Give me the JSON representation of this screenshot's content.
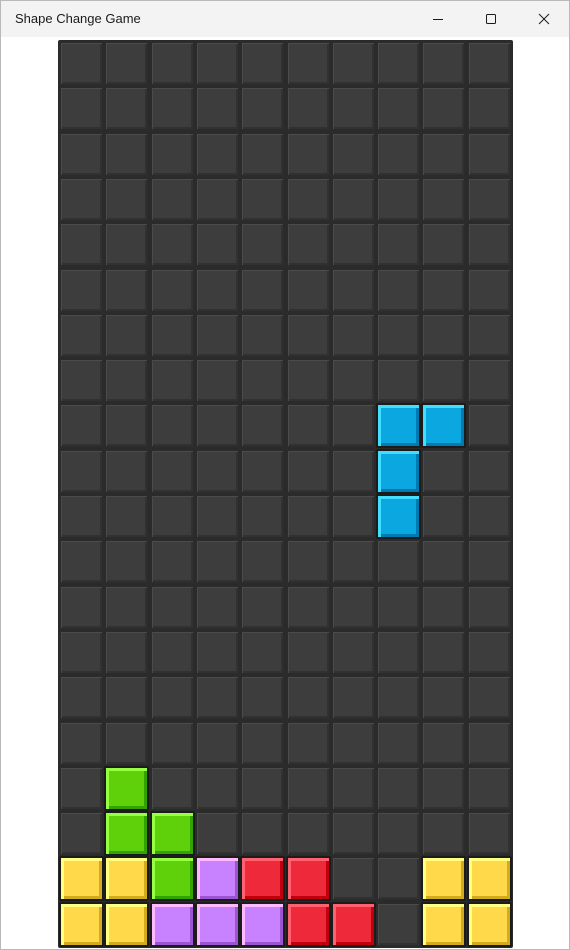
{
  "window": {
    "title": "Shape Change Game"
  },
  "game": {
    "columns": 10,
    "rows": 20,
    "colors": {
      "empty": "#3d3d3d",
      "grid_line": "#2b2b2b",
      "cyan": "#0aa7e0",
      "green": "#5fd10a",
      "yellow": "#ffd94a",
      "purple": "#c882ff",
      "red": "#ee2a3a"
    },
    "active_piece": {
      "color": "cyan",
      "cells": [
        [
          7,
          8
        ],
        [
          8,
          8
        ],
        [
          7,
          9
        ],
        [
          7,
          10
        ]
      ]
    },
    "locked_cells": [
      {
        "col": 1,
        "row": 16,
        "color": "green"
      },
      {
        "col": 1,
        "row": 17,
        "color": "green"
      },
      {
        "col": 2,
        "row": 17,
        "color": "green"
      },
      {
        "col": 0,
        "row": 18,
        "color": "yellow"
      },
      {
        "col": 1,
        "row": 18,
        "color": "yellow"
      },
      {
        "col": 2,
        "row": 18,
        "color": "green"
      },
      {
        "col": 3,
        "row": 18,
        "color": "purple"
      },
      {
        "col": 4,
        "row": 18,
        "color": "red"
      },
      {
        "col": 5,
        "row": 18,
        "color": "red"
      },
      {
        "col": 8,
        "row": 18,
        "color": "yellow"
      },
      {
        "col": 9,
        "row": 18,
        "color": "yellow"
      },
      {
        "col": 0,
        "row": 19,
        "color": "yellow"
      },
      {
        "col": 1,
        "row": 19,
        "color": "yellow"
      },
      {
        "col": 2,
        "row": 19,
        "color": "purple"
      },
      {
        "col": 3,
        "row": 19,
        "color": "purple"
      },
      {
        "col": 4,
        "row": 19,
        "color": "purple"
      },
      {
        "col": 5,
        "row": 19,
        "color": "red"
      },
      {
        "col": 6,
        "row": 19,
        "color": "red"
      },
      {
        "col": 8,
        "row": 19,
        "color": "yellow"
      },
      {
        "col": 9,
        "row": 19,
        "color": "yellow"
      }
    ]
  }
}
